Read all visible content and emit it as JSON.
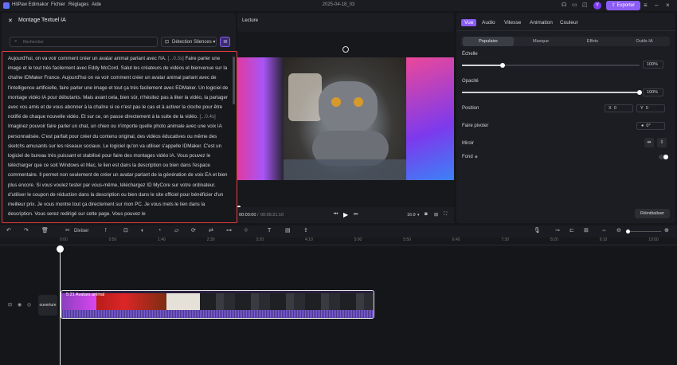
{
  "titlebar": {
    "app_name": "HitPaw Edimakor",
    "menu": [
      "Fichier",
      "Réglages",
      "Aide"
    ],
    "project_title": "2025-04-18_03",
    "avatar_letter": "Y",
    "export_label": "Exporter"
  },
  "left_panel": {
    "title": "Montage Textuel IA",
    "search_placeholder": "Rechercher",
    "detect_label": "Détection Silences",
    "transcript": [
      {
        "t": "Aujourd'hui, on va voir comment créer un avatar animal parlant avec l'IA. "
      },
      {
        "tag": "[...0.3s]"
      },
      {
        "t": " Faire parler une image et le tout très facilement avec Eddy McCord. Salut les créateurs de vidéos et bienvenue sur la chaîne IDMaker France. Aujourd'hui on va voir comment créer un avatar animal parlant avec de l'intelligence artificielle, faire parler une image et tout ça très facilement avec EDMaker. Un logiciel de montage vidéo IA pour débutants. Mais avant cela, bien sûr, n'hésitez pas à liker la vidéo, la partager avec vos amis et de vous abonner à la chaîne si ce n'est pas le cas et à activer la cloche pour être notifié de chaque nouvelle vidéo. Et sur ce, on passe directement à la suite de la vidéo. "
      },
      {
        "tag": "[...0.4s]"
      },
      {
        "t": " Imaginez pouvoir faire parler un chat, un chien ou n'importe quelle photo animale avec une voix IA personnalisée. C'est parfait pour créer du contenu original, des vidéos éducatives ou même des sketchs amusants sur les réseaux sociaux. Le logiciel qu'on va utiliser s'appelle IDMaker. C'est un logiciel de bureau très puissant et stabilisé pour faire des montages vidéo IA. Vous pouvez le télécharger que ce soit Windows et Mac, le lien est dans la description ou bien dans l'espace commentaire. Il permet non seulement de créer un avatar parlant de la génération de voix EA et bien plus encore. Si vous voulez tester par vous-même, téléchargez ID MyCore sur votre ordinateur. d'utiliser le coupon de réduction dans la description ou bien dans le site officiel pour bénéficier d'un meilleur prix. Je vous montre tout ça directement sur mon PC. Je vous mets le lien dans la description. Vous serez redirigé sur cette page. Vous pouvez le"
      }
    ]
  },
  "preview": {
    "title": "Lecture",
    "time_current": "00:00:00",
    "time_total": "00:05:21:10",
    "aspect": "16:9"
  },
  "right_panel": {
    "tabs": [
      "Vue",
      "Audio",
      "Vitesse",
      "Animation",
      "Couleur"
    ],
    "active_tab": "Vue",
    "sub_tabs": [
      "Populaire",
      "Masque",
      "Effets",
      "Outils IA"
    ],
    "active_sub_tab": "Populaire",
    "scale_label": "Échelle",
    "scale_value": "100%",
    "scale_fraction": 0.23,
    "opacity_label": "Opacité",
    "opacity_value": "100%",
    "opacity_fraction": 1.0,
    "position_label": "Position",
    "pos_x_label": "X",
    "pos_x_value": "0",
    "pos_y_label": "Y",
    "pos_y_value": "0",
    "rotate_label": "Faire pivoter",
    "rotate_value": "0°",
    "mirror_label": "Miroir",
    "background_label": "Fond",
    "reset_label": "Réinitialiser"
  },
  "toolbar": {
    "split_label": "Diviser"
  },
  "ruler": [
    "0:00",
    "0:50",
    "1:40",
    "2:30",
    "3:20",
    "4:10",
    "5:00",
    "5:50",
    "6:40",
    "7:30",
    "8:20",
    "9:10",
    "10:00"
  ],
  "timeline": {
    "track_name": "ouverture",
    "clip_label": "5:21 Avatars animal"
  }
}
